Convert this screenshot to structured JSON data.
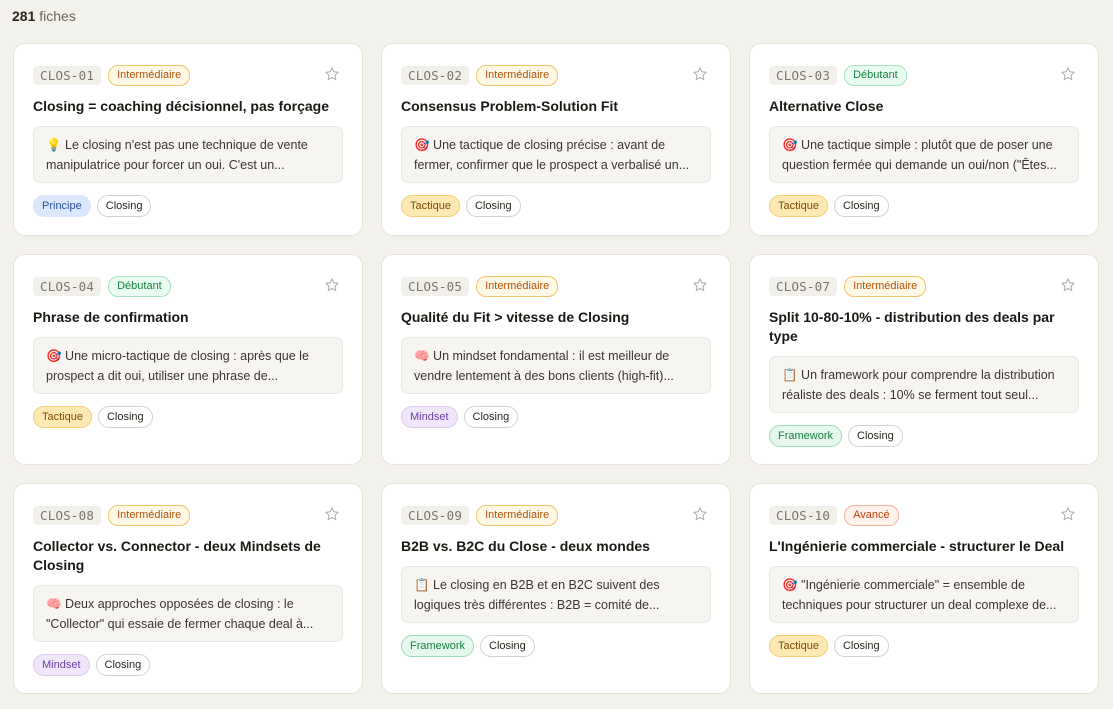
{
  "header": {
    "count": "281",
    "count_label": "fiches"
  },
  "icons": {
    "favorite": "star-outline-icon"
  },
  "cards": [
    {
      "code": "CLOS-01",
      "level": "Intermédiaire",
      "title": "Closing = coaching décisionnel, pas forçage",
      "excerpt_1": "💡 Le closing n'est pas une technique de vente",
      "excerpt_2": "manipulatrice pour forcer un oui. C'est un...",
      "tag_type": "Principe",
      "tag_category": "Closing"
    },
    {
      "code": "CLOS-02",
      "level": "Intermédiaire",
      "title": "Consensus Problem-Solution Fit",
      "excerpt_1": "🎯 Une tactique de closing précise : avant de",
      "excerpt_2": "fermer, confirmer que le prospect a verbalisé un...",
      "tag_type": "Tactique",
      "tag_category": "Closing"
    },
    {
      "code": "CLOS-03",
      "level": "Débutant",
      "title": "Alternative Close",
      "excerpt_1": "🎯 Une tactique simple : plutôt que de poser une",
      "excerpt_2": "question fermée qui demande un oui/non (\"Êtes...",
      "tag_type": "Tactique",
      "tag_category": "Closing"
    },
    {
      "code": "CLOS-04",
      "level": "Débutant",
      "title": "Phrase de confirmation",
      "excerpt_1": "🎯 Une micro-tactique de closing : après que le",
      "excerpt_2": "prospect a dit oui, utiliser une phrase de...",
      "tag_type": "Tactique",
      "tag_category": "Closing"
    },
    {
      "code": "CLOS-05",
      "level": "Intermédiaire",
      "title": "Qualité du Fit > vitesse de Closing",
      "excerpt_1": "🧠 Un mindset fondamental : il est meilleur de",
      "excerpt_2": "vendre lentement à des bons clients (high-fit)...",
      "tag_type": "Mindset",
      "tag_category": "Closing"
    },
    {
      "code": "CLOS-07",
      "level": "Intermédiaire",
      "title": "Split 10-80-10% - distribution des deals par type",
      "excerpt_1": "📋 Un framework pour comprendre la distribution",
      "excerpt_2": "réaliste des deals : 10% se ferment tout seul...",
      "tag_type": "Framework",
      "tag_category": "Closing"
    },
    {
      "code": "CLOS-08",
      "level": "Intermédiaire",
      "title": "Collector vs. Connector - deux Mindsets de Closing",
      "excerpt_1": "🧠 Deux approches opposées de closing : le",
      "excerpt_2": "\"Collector\" qui essaie de fermer chaque deal à...",
      "tag_type": "Mindset",
      "tag_category": "Closing"
    },
    {
      "code": "CLOS-09",
      "level": "Intermédiaire",
      "title": "B2B vs. B2C du Close - deux mondes",
      "excerpt_1": "📋 Le closing en B2B et en B2C suivent des",
      "excerpt_2": "logiques très différentes : B2B = comité de...",
      "tag_type": "Framework",
      "tag_category": "Closing"
    },
    {
      "code": "CLOS-10",
      "level": "Avancé",
      "title": "L'Ingénierie commerciale - structurer le Deal",
      "excerpt_1": "🎯 \"Ingénierie commerciale\" = ensemble de",
      "excerpt_2": "techniques pour structurer un deal complexe de...",
      "tag_type": "Tactique",
      "tag_category": "Closing"
    }
  ]
}
